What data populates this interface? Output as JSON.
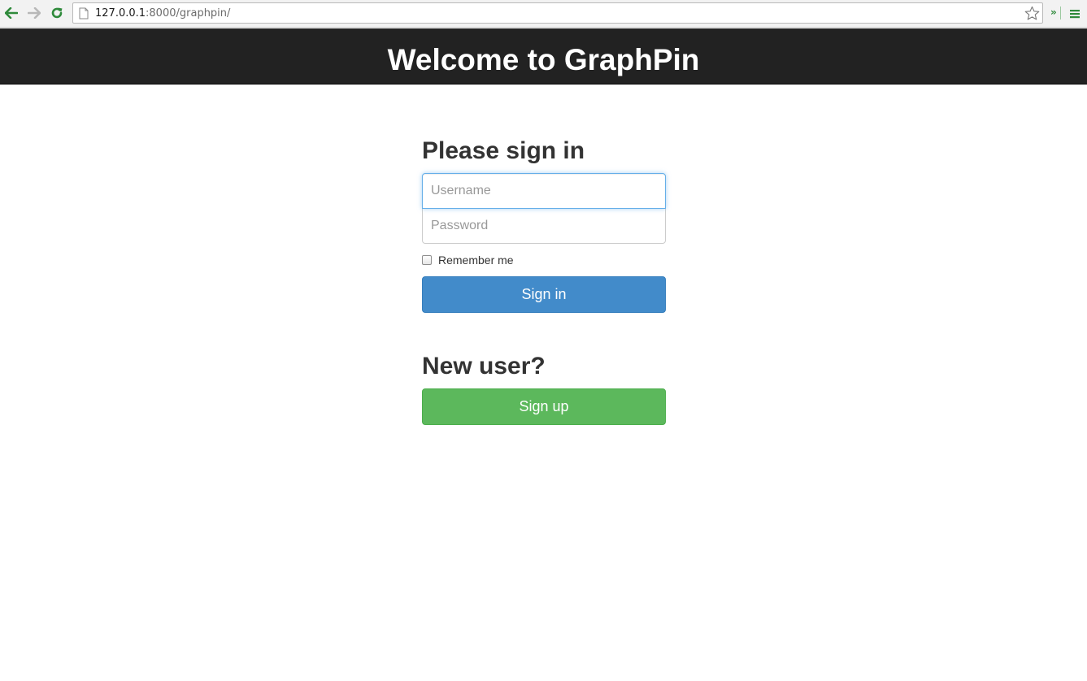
{
  "browser": {
    "url_host": "127.0.0.1",
    "url_rest": ":8000/graphpin/",
    "extension_chevron": "»",
    "icons": {
      "back": "arrow-left-icon",
      "forward": "arrow-right-icon",
      "reload": "reload-icon",
      "page": "page-icon",
      "bookmark": "star-icon",
      "menu": "hamburger-menu-icon"
    },
    "colors": {
      "nav_active": "#2f8a3b",
      "nav_disabled": "#b8b8b8"
    }
  },
  "header": {
    "title": "Welcome to GraphPin",
    "background": "#222222"
  },
  "signin": {
    "heading": "Please sign in",
    "username_placeholder": "Username",
    "password_placeholder": "Password",
    "remember_label": "Remember me",
    "remember_checked": false,
    "submit_label": "Sign in",
    "submit_color": "#428bca"
  },
  "signup": {
    "heading": "New user?",
    "button_label": "Sign up",
    "button_color": "#5cb85c"
  }
}
